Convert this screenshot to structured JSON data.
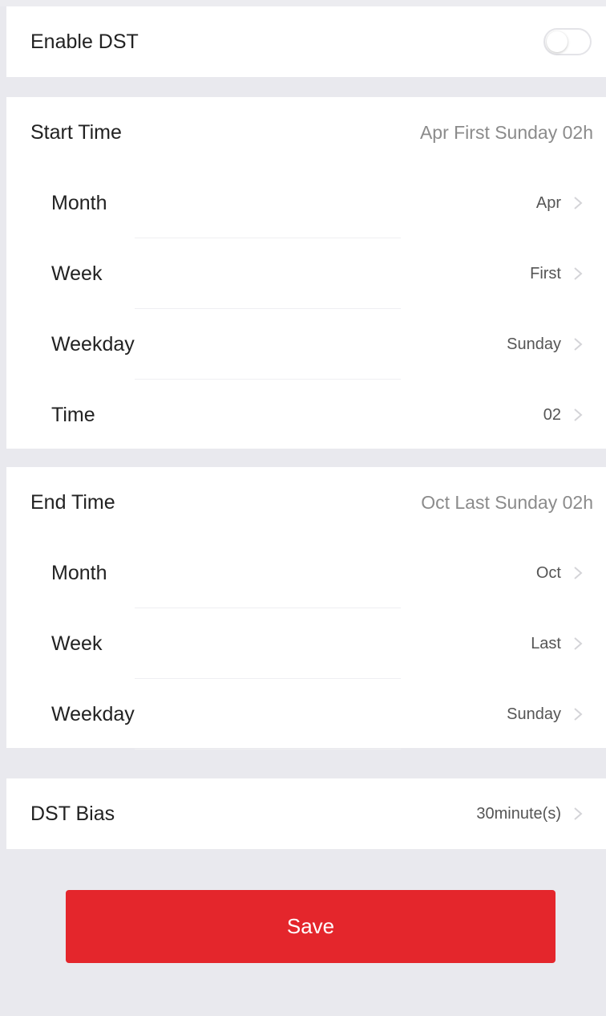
{
  "enable_dst": {
    "label": "Enable DST",
    "enabled": false
  },
  "start_time": {
    "label": "Start Time",
    "summary": "Apr First Sunday 02h",
    "rows": [
      {
        "key": "month",
        "label": "Month",
        "value": "Apr"
      },
      {
        "key": "week",
        "label": "Week",
        "value": "First"
      },
      {
        "key": "weekday",
        "label": "Weekday",
        "value": "Sunday"
      },
      {
        "key": "time",
        "label": "Time",
        "value": "02"
      }
    ]
  },
  "end_time": {
    "label": "End Time",
    "summary": "Oct Last Sunday 02h",
    "rows": [
      {
        "key": "month",
        "label": "Month",
        "value": "Oct"
      },
      {
        "key": "week",
        "label": "Week",
        "value": "Last"
      },
      {
        "key": "weekday",
        "label": "Weekday",
        "value": "Sunday"
      }
    ]
  },
  "dst_bias": {
    "label": "DST Bias",
    "value": "30minute(s)"
  },
  "save_button": {
    "label": "Save"
  },
  "icons": {
    "chevron": "chevron-right-icon"
  },
  "colors": {
    "accent": "#e4262c",
    "background": "#e9e9ee",
    "card": "#ffffff"
  }
}
